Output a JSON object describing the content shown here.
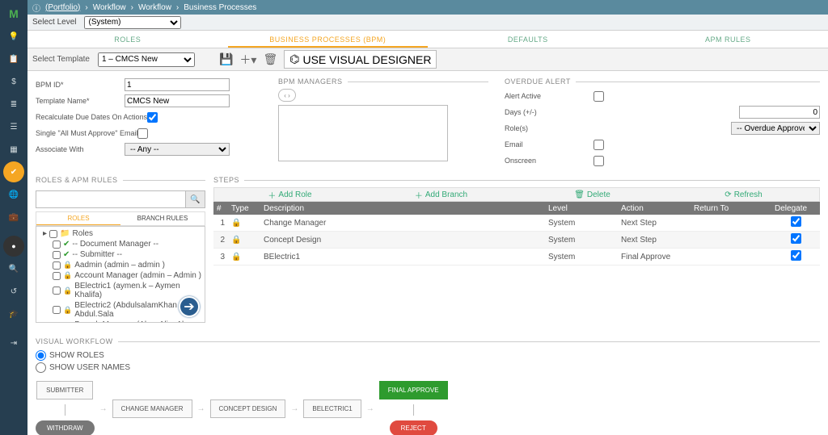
{
  "sidebar": {
    "items": [
      "logo",
      "bulb",
      "clipboard",
      "dollar",
      "bars",
      "switches",
      "grid",
      "check",
      "globe",
      "briefcase",
      "avatar",
      "search",
      "undo",
      "grad",
      "exit"
    ]
  },
  "breadcrumb": {
    "portfolio": "(Portfolio)",
    "p1": "Workflow",
    "p2": "Workflow",
    "p3": "Business Processes"
  },
  "level": {
    "label": "Select Level",
    "value": "(System)"
  },
  "tabs": {
    "roles": "ROLES",
    "bpm": "BUSINESS PROCESSES (BPM)",
    "defaults": "DEFAULTS",
    "apm": "APM RULES"
  },
  "toolbar": {
    "label": "Select Template",
    "value": "1 – CMCS New",
    "visual": "USE VISUAL DESIGNER"
  },
  "form": {
    "bpmid_label": "BPM ID*",
    "bpmid_value": "1",
    "tname_label": "Template Name*",
    "tname_value": "CMCS New",
    "recalc_label": "Recalculate Due Dates On Actions",
    "single_label": "Single \"All Must Approve\" Email",
    "assoc_label": "Associate With",
    "assoc_value": "-- Any --"
  },
  "bpm_mgr": {
    "legend": "BPM MANAGERS",
    "pager": "‹ ›"
  },
  "overdue": {
    "legend": "OVERDUE ALERT",
    "active": "Alert Active",
    "days": "Days (+/-)",
    "days_value": "0",
    "roles_label": "Role(s)",
    "roles_value": "-- Overdue Approver --",
    "email": "Email",
    "onscreen": "Onscreen"
  },
  "rules": {
    "legend": "ROLES & APM RULES",
    "search_ph": "",
    "tab_roles": "ROLES",
    "tab_branch": "BRANCH RULES",
    "root": "Roles",
    "nodes": [
      "-- Document Manager --",
      "-- Submitter --",
      "Aadmin (admin – admin )",
      "Account Manager (admin – Admin )",
      "BElectric1 (aymen.k – Aymen Khalifa)",
      "BElectric2 (AbdulsalamKhan – Abdul.Sala",
      "Branch Manager (AbrarAli – Abrar Ali)"
    ]
  },
  "steps": {
    "legend": "STEPS",
    "addrole": "Add Role",
    "addbranch": "Add Branch",
    "delete": "Delete",
    "refresh": "Refresh",
    "cols": {
      "num": "#",
      "type": "Type",
      "desc": "Description",
      "level": "Level",
      "action": "Action",
      "return": "Return To",
      "delegate": "Delegate"
    },
    "rows": [
      {
        "n": "1",
        "desc": "Change Manager",
        "level": "System",
        "action": "Next Step",
        "delegate": true
      },
      {
        "n": "2",
        "desc": "Concept Design",
        "level": "System",
        "action": "Next Step",
        "delegate": true
      },
      {
        "n": "3",
        "desc": "BElectric1",
        "level": "System",
        "action": "Final Approve",
        "delegate": true
      }
    ]
  },
  "vwf": {
    "legend": "VISUAL WORKFLOW",
    "show_roles": "SHOW ROLES",
    "show_users": "SHOW USER NAMES",
    "nodes": {
      "submitter": "SUBMITTER",
      "withdraw": "WITHDRAW",
      "cm": "CHANGE MANAGER",
      "cd": "CONCEPT DESIGN",
      "be": "BELECTRIC1",
      "fa": "FINAL APPROVE",
      "reject": "REJECT"
    }
  }
}
